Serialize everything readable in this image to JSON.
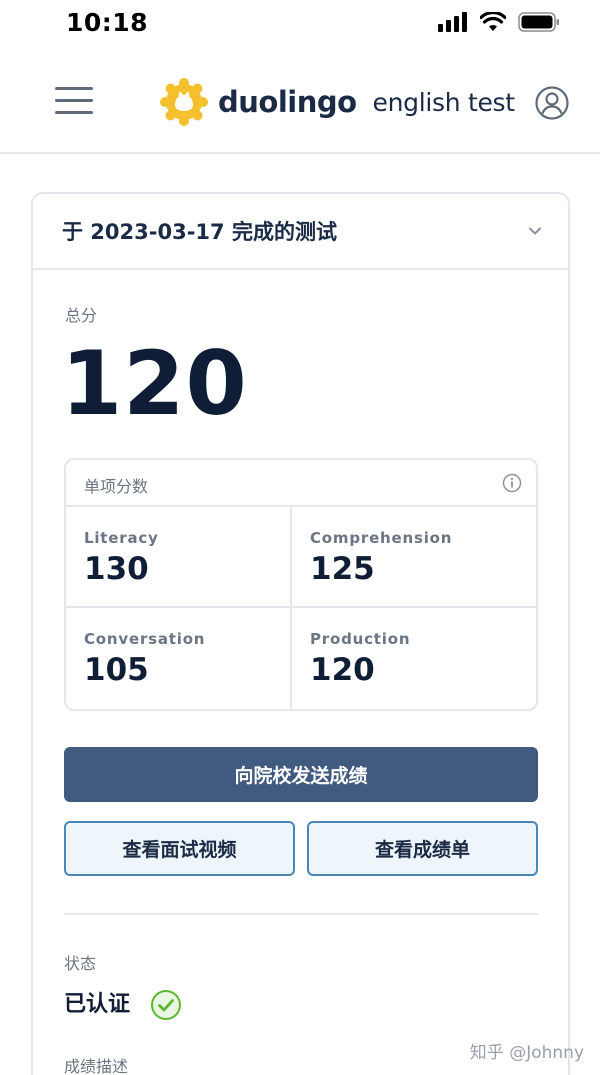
{
  "status_bar": {
    "time": "10:18",
    "icons": [
      "signal-icon",
      "wifi-icon",
      "battery-icon"
    ]
  },
  "header": {
    "brand": "duolingo",
    "brand_suffix": "english test",
    "logo_color": "#f4c02e",
    "icons": [
      "menu-icon",
      "account-icon"
    ]
  },
  "card": {
    "title": "于 2023-03-17 完成的测试",
    "overall_label": "总分",
    "overall_score": "120",
    "subscores_title": "单项分数",
    "subscores": [
      {
        "label": "Literacy",
        "value": "130"
      },
      {
        "label": "Comprehension",
        "value": "125"
      },
      {
        "label": "Conversation",
        "value": "105"
      },
      {
        "label": "Production",
        "value": "120"
      }
    ],
    "send_button": "向院校发送成绩",
    "video_button": "查看面试视频",
    "report_button": "查看成绩单",
    "status_label": "状态",
    "status_value": "已认证",
    "description_label": "成绩描述"
  },
  "watermark": "知乎 @Johnny",
  "colors": {
    "primary_button": "#415a80",
    "outline_border": "#4a86b8",
    "outline_bg": "#eef5fb",
    "check_green": "#5cb82e"
  }
}
